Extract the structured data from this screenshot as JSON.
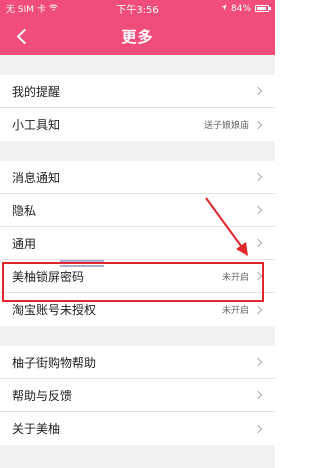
{
  "status_bar": {
    "carrier": "无 SIM 卡",
    "time": "下午3:56",
    "battery": "84%"
  },
  "nav": {
    "title": "更多"
  },
  "groups": [
    {
      "items": [
        {
          "label": "我的提醒",
          "value": ""
        },
        {
          "label": "小工具知",
          "value": "送子娘娘庙"
        }
      ]
    },
    {
      "items": [
        {
          "label": "消息通知",
          "value": ""
        },
        {
          "label": "隐私",
          "value": ""
        },
        {
          "label": "通用",
          "value": ""
        },
        {
          "label": "美柚锁屏密码",
          "value": "未开启"
        },
        {
          "label": "淘宝账号未授权",
          "value": "未开启"
        }
      ]
    },
    {
      "items": [
        {
          "label": "柚子街购物帮助",
          "value": ""
        },
        {
          "label": "帮助与反馈",
          "value": ""
        },
        {
          "label": "关于美柚",
          "value": ""
        }
      ]
    }
  ],
  "colors": {
    "header": "#f04d7b",
    "highlight": "#e0272b",
    "background": "#f2f2f2"
  }
}
